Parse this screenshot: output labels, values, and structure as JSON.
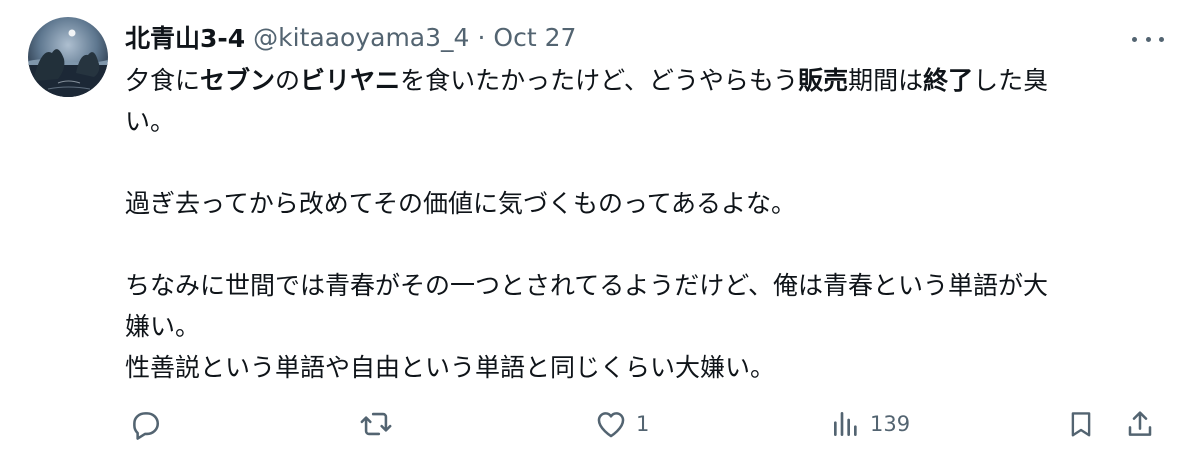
{
  "tweet": {
    "display_name": "北青山3-4",
    "handle": "@kitaaoyama3_4",
    "separator": "·",
    "date": "Oct 27",
    "body": {
      "p1_line1_a": "夕食に",
      "p1_line1_b": "セブン",
      "p1_line1_c": "の",
      "p1_line1_d": "ビリヤニ",
      "p1_line1_e": "を食いたかったけど、どうやらもう",
      "p1_line1_f": "販売",
      "p1_line1_g": "期間は",
      "p1_line1_h": "終了",
      "p1_line1_i": "した臭",
      "p1_line2": "い。",
      "p2": "過ぎ去ってから改めてその価値に気づくものってあるよな。",
      "p3_line1": "ちなみに世間では青春がその一つとされてるようだけど、俺は青春という単語が大",
      "p3_line2": "嫌い。",
      "p3_line3": "性善説という単語や自由という単語と同じくらい大嫌い。"
    },
    "actions": {
      "reply_icon": "reply-icon",
      "retweet_icon": "retweet-icon",
      "like_icon": "heart-icon",
      "like_count": "1",
      "views_icon": "views-icon",
      "views_count": "139",
      "bookmark_icon": "bookmark-icon",
      "share_icon": "share-icon"
    },
    "colors": {
      "text": "#0f1419",
      "secondary": "#536471"
    }
  }
}
